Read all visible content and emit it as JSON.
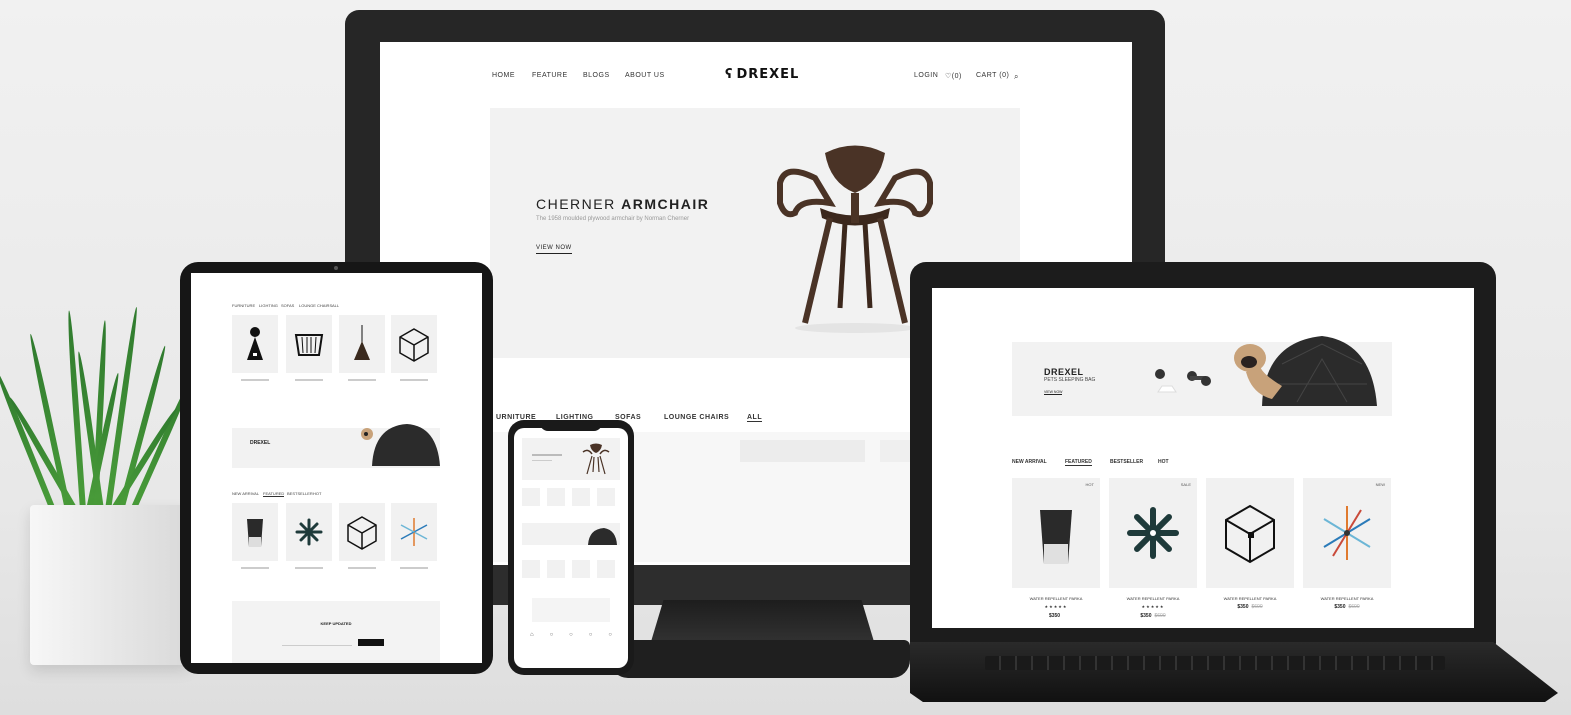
{
  "monitor": {
    "nav": {
      "home": "HOME",
      "feature": "FEATURE",
      "blogs": "BLOGS",
      "about": "ABOUT US",
      "login": "LOGIN",
      "wishlist": "(0)",
      "cart": "CART (0)"
    },
    "logo": "DREXEL",
    "hero": {
      "title_light": "CHERNER",
      "title_bold": "ARMCHAIR",
      "subtitle": "The 1958 moulded plywood armchair by Norman Cherner",
      "button": "VIEW NOW"
    },
    "categories": [
      "URNITURE",
      "LIGHTING",
      "SOFAS",
      "LOUNGE CHAIRS",
      "ALL"
    ]
  },
  "laptop": {
    "banner": {
      "brand": "DREXEL",
      "product": "PETS SLEEPING BAG",
      "button": "VIEW NOW"
    },
    "tabs": [
      "NEW ARRIVAL",
      "FEATURED",
      "BESTSELLER",
      "HOT"
    ],
    "products": [
      {
        "name": "WATER REPELLENT PARKA",
        "badge": "HOT",
        "stars": "★★★★★",
        "price": "$350",
        "old_price": ""
      },
      {
        "name": "WATER REPELLENT PARKA",
        "badge": "SALE",
        "stars": "★★★★★",
        "price": "$350",
        "old_price": "$600"
      },
      {
        "name": "WATER REPELLENT PARKA",
        "badge": "",
        "stars": "",
        "price": "$350",
        "old_price": "$600"
      },
      {
        "name": "WATER REPELLENT PARKA",
        "badge": "NEW",
        "stars": "",
        "price": "$350",
        "old_price": "$600"
      }
    ]
  },
  "tablet": {
    "tabs_top": [
      "FURNITURE",
      "LIGHTING",
      "SOFAS",
      "LOUNGE CHAIRS",
      "ALL"
    ],
    "banner_brand": "DREXEL",
    "tabs_mid": [
      "NEW ARRIVAL",
      "FEATURED",
      "BESTSELLER",
      "HOT"
    ],
    "newsletter": "KEEP UPDATED"
  },
  "colors": {
    "device": "#1c1c1c",
    "chair": "#4a3326",
    "dome": "#2b2b2b",
    "plant": "#3d8b34"
  }
}
